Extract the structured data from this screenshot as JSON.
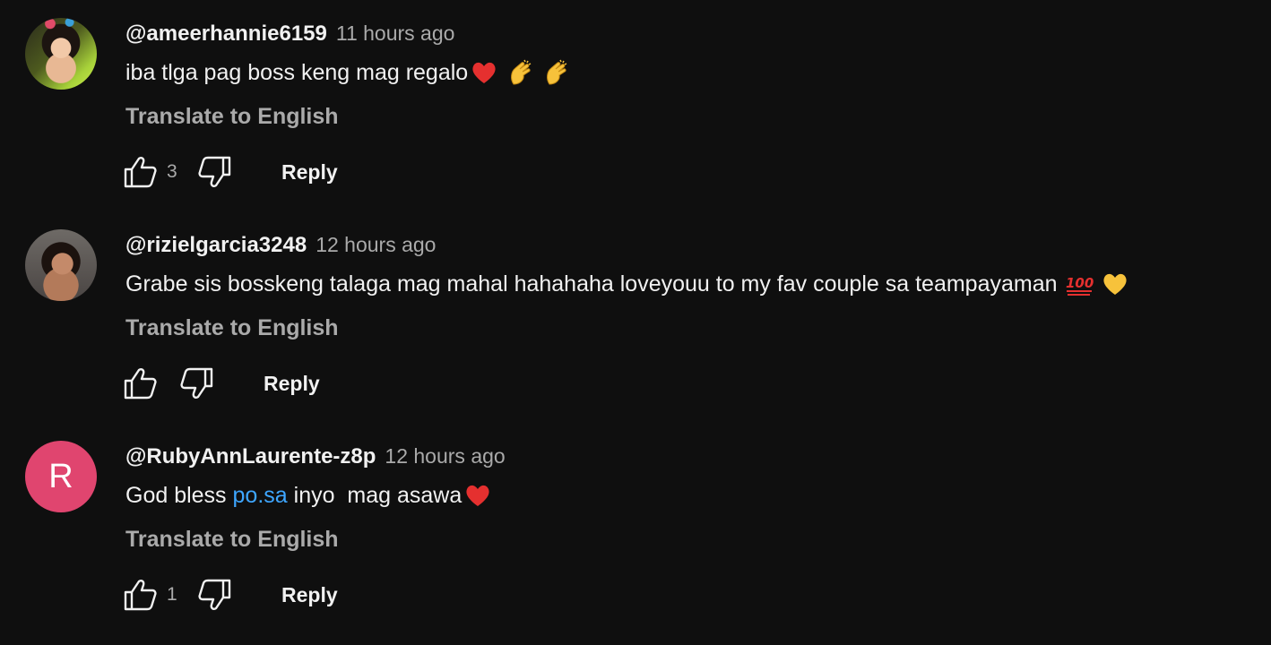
{
  "comments": [
    {
      "username": "@ameerhannie6159",
      "timestamp": "11 hours ago",
      "text": "iba tlga pag boss keng mag regalo",
      "emojis": [
        "red-heart",
        "clapping-hands",
        "clapping-hands"
      ],
      "translate_label": "Translate to English",
      "like_count": "3",
      "reply_label": "Reply"
    },
    {
      "username": "@rizielgarcia3248",
      "timestamp": "12 hours ago",
      "text": "Grabe sis bosskeng talaga mag mahal hahahaha loveyouu to my fav couple sa teampayaman",
      "emojis": [
        "hundred-points",
        "yellow-heart"
      ],
      "translate_label": "Translate to English",
      "like_count": "",
      "reply_label": "Reply"
    },
    {
      "username": "@RubyAnnLaurente-z8p",
      "avatar_letter": "R",
      "avatar_color": "#e0456f",
      "timestamp": "12 hours ago",
      "text_before_link": "God bless ",
      "link_text": "po.sa",
      "text_after_link": " inyo  mag asawa",
      "emojis": [
        "red-heart"
      ],
      "translate_label": "Translate to English",
      "like_count": "1",
      "reply_label": "Reply"
    }
  ],
  "colors": {
    "background": "#0f0f0f",
    "primary_text": "#f1f1f1",
    "secondary_text": "#aaaaaa",
    "link": "#3ea6ff"
  }
}
